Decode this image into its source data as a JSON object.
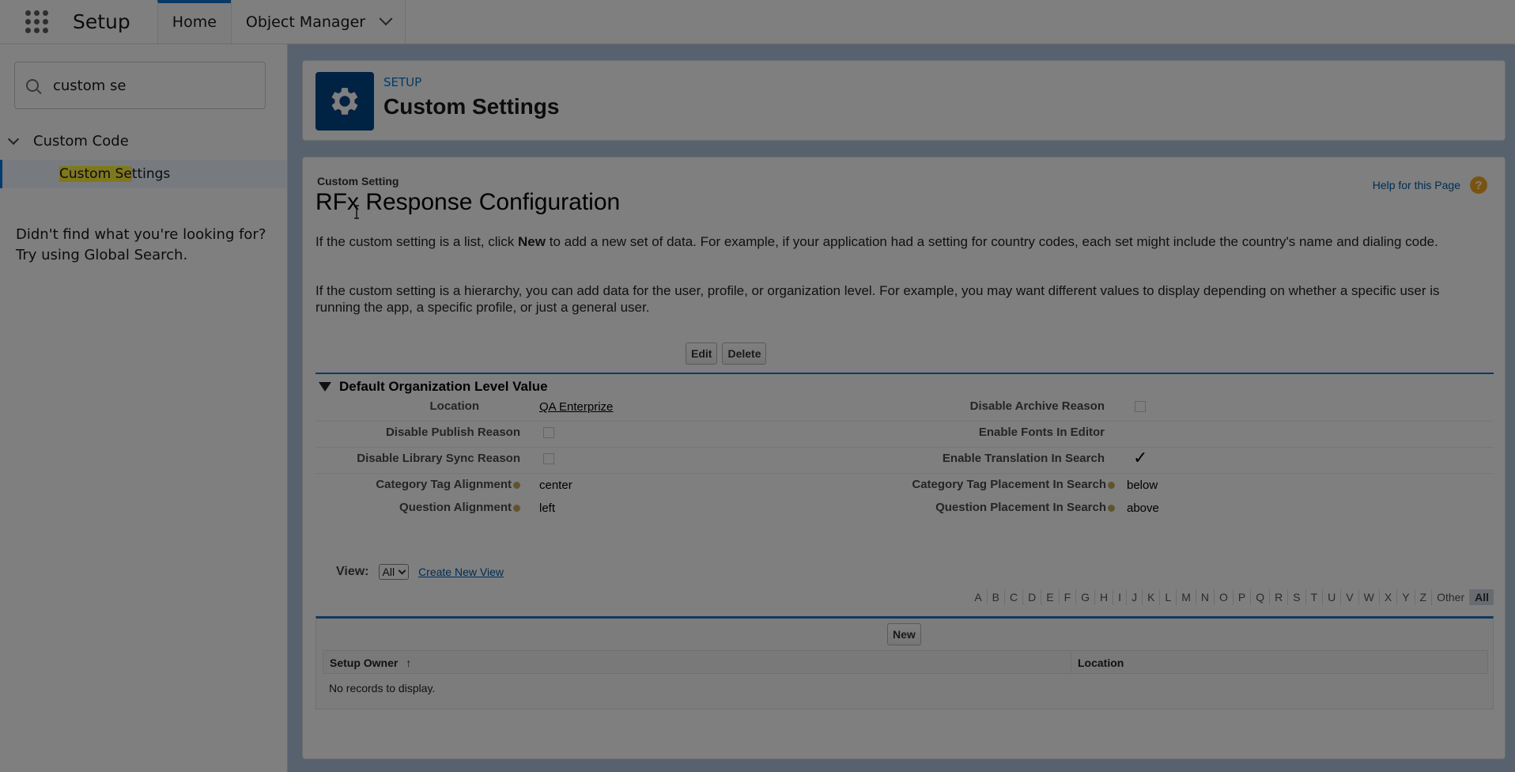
{
  "topbar": {
    "app_name": "Setup",
    "tabs": [
      {
        "label": "Home"
      },
      {
        "label": "Object Manager"
      }
    ]
  },
  "sidebar": {
    "search_value": "custom se",
    "tree_parent": "Custom Code",
    "tree_child_highlight": "Custom Se",
    "tree_child_rest": "ttings",
    "not_found_line1": "Didn't find what you're looking for?",
    "not_found_line2": "Try using Global Search."
  },
  "header": {
    "kicker": "SETUP",
    "title": "Custom Settings"
  },
  "detail": {
    "kicker": "Custom Setting",
    "title": "RFx Response Configuration",
    "help_link": "Help for this Page",
    "help_icon": "?",
    "para1_a": "If the custom setting is a list, click ",
    "para1_b": "New",
    "para1_c": " to add a new set of data. For example, if your application had a setting for country codes, each set might include the country's name and dialing code.",
    "para2": "If the custom setting is a hierarchy, you can add data for the user, profile, or organization level. For example, you may want different values to display depending on whether a specific user is running the app, a specific profile, or just a general user.",
    "edit_label": "Edit",
    "delete_label": "Delete",
    "section_title": "Default Organization Level Value",
    "fields": {
      "location_label": "Location",
      "location_value": "QA Enterprize",
      "disable_archive_label": "Disable Archive Reason",
      "disable_publish_label": "Disable Publish Reason",
      "enable_fonts_label": "Enable Fonts In Editor",
      "disable_library_label": "Disable Library Sync Reason",
      "enable_translation_label": "Enable Translation In Search",
      "enable_translation_check": "✓",
      "category_tag_alignment_label": "Category Tag Alignment",
      "category_tag_alignment_value": "center",
      "category_tag_placement_label": "Category Tag Placement In Search",
      "category_tag_placement_value": "below",
      "question_alignment_label": "Question Alignment",
      "question_alignment_value": "left",
      "question_placement_label": "Question Placement In Search",
      "question_placement_value": "above"
    },
    "view_label": "View:",
    "view_selected": "All",
    "create_new_view": "Create New View",
    "alphabet": [
      "A",
      "B",
      "C",
      "D",
      "E",
      "F",
      "G",
      "H",
      "I",
      "J",
      "K",
      "L",
      "M",
      "N",
      "O",
      "P",
      "Q",
      "R",
      "S",
      "T",
      "U",
      "V",
      "W",
      "X",
      "Y",
      "Z",
      "Other",
      "All"
    ],
    "new_label": "New",
    "col_setup_owner": "Setup Owner",
    "sort_arrow": "↑",
    "col_location": "Location",
    "no_records": "No records to display."
  }
}
